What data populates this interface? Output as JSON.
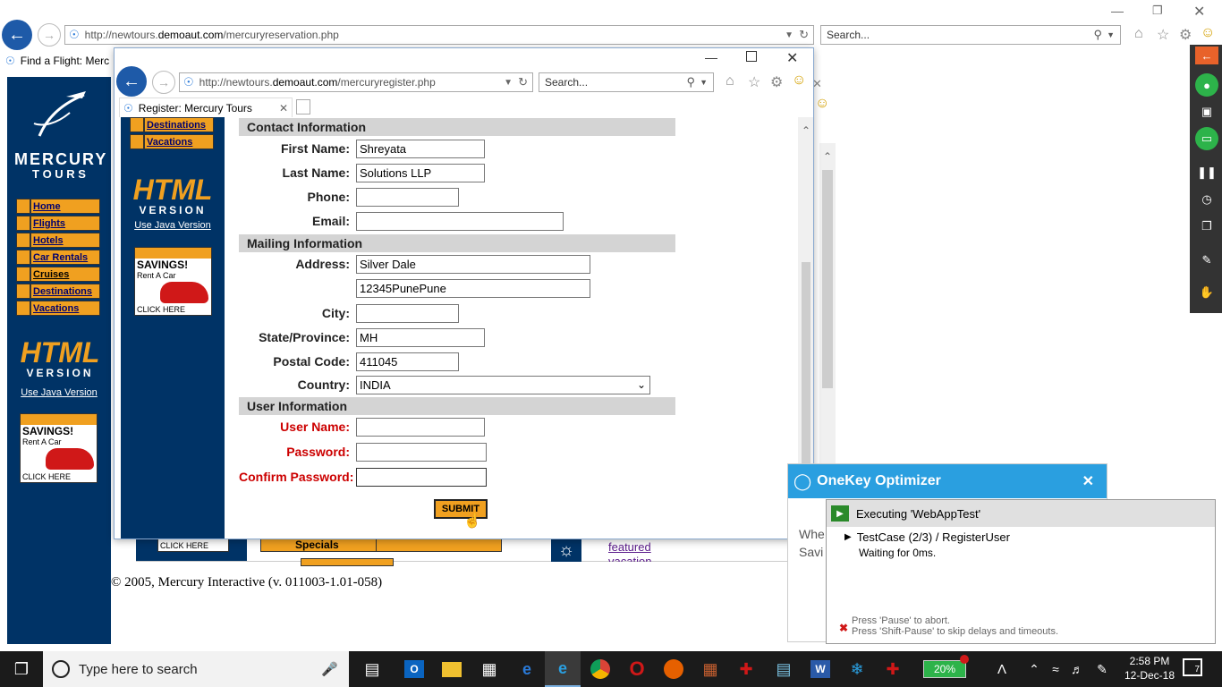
{
  "outer_browser": {
    "url_prefix": "http://newtours.",
    "url_domain": "demoaut.com",
    "url_path": "/mercuryreservation.php",
    "search_placeholder": "Search...",
    "tab_title": "Find a Flight: Merc"
  },
  "inner_browser": {
    "url_prefix": "http://newtours.",
    "url_domain": "demoaut.com",
    "url_path": "/mercuryregister.php",
    "search_placeholder": "Search...",
    "tab_title": "Register: Mercury Tours"
  },
  "outer_sidebar": {
    "logo_line1": "MERCURY",
    "logo_line2": "T O U R S",
    "items": [
      {
        "label": "Home"
      },
      {
        "label": "Flights"
      },
      {
        "label": "Hotels"
      },
      {
        "label": "Car Rentals"
      },
      {
        "label": "Cruises"
      },
      {
        "label": "Destinations"
      },
      {
        "label": "Vacations"
      }
    ],
    "html_version_line1": "HTML",
    "html_version_line2": "VERSION",
    "java_link": "Use Java Version",
    "ad_title": "SAVINGS!",
    "ad_sub": "Rent A Car",
    "ad_cta": "CLICK HERE"
  },
  "inner_sidebar": {
    "items": [
      {
        "label": "Destinations"
      },
      {
        "label": "Vacations"
      }
    ],
    "html_version_line1": "HTML",
    "html_version_line2": "VERSION",
    "java_link": "Use Java Version",
    "ad_title": "SAVINGS!",
    "ad_sub": "Rent A Car",
    "ad_cta": "CLICK HERE"
  },
  "form": {
    "contact_header": "Contact Information",
    "first_name_label": "First Name:",
    "first_name_value": "Shreyata",
    "last_name_label": "Last Name:",
    "last_name_value": "Solutions LLP",
    "phone_label": "Phone:",
    "phone_value": "",
    "email_label": "Email:",
    "email_value": "",
    "mailing_header": "Mailing Information",
    "address_label": "Address:",
    "address1_value": "Silver Dale",
    "address2_value": "12345PunePune",
    "city_label": "City:",
    "city_value": "",
    "state_label": "State/Province:",
    "state_value": "MH",
    "postal_label": "Postal Code:",
    "postal_value": "411045",
    "country_label": "Country:",
    "country_value": "INDIA",
    "user_header": "User Information",
    "username_label": "User Name:",
    "password_label": "Password:",
    "confirm_label": "Confirm Password:",
    "submit_label": "SUBMIT"
  },
  "background_page": {
    "cta": "CLICK HERE",
    "specials": "Specials",
    "featured": "featured",
    "vacation": "vacation",
    "copyright": "© 2005, Mercury Interactive (v. 011003-1.01-058)"
  },
  "onekey": {
    "title": "OneKey Optimizer",
    "partial_text1": "Whe",
    "partial_text2": "Savi"
  },
  "executing": {
    "title": "Executing 'WebAppTest'",
    "testcase": "TestCase (2/3) / RegisterUser",
    "waiting": "Waiting for 0ms.",
    "hint1": "Press 'Pause' to abort.",
    "hint2": "Press 'Shift-Pause' to skip delays and timeouts."
  },
  "taskbar": {
    "search_placeholder": "Type here to search",
    "battery": "20%",
    "time": "2:58 PM",
    "date": "12-Dec-18",
    "notifications": "7"
  },
  "colors": {
    "mercury_blue": "#003366",
    "nav_orange": "#f0a020",
    "onekey_blue": "#2a9fe0",
    "recorder_green": "#2db34a",
    "taskbar": "#1b1b1b"
  }
}
